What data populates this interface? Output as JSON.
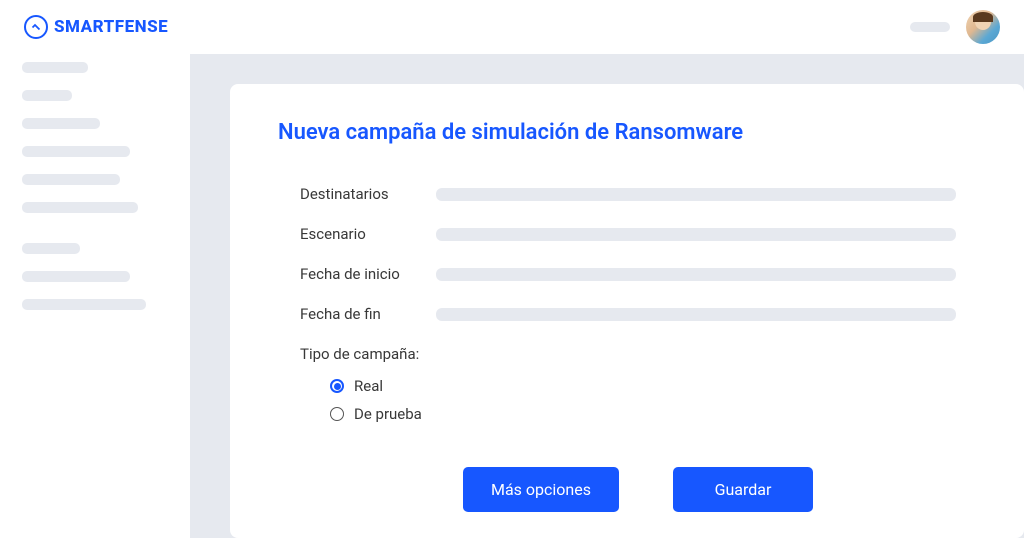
{
  "brand": "SMARTFENSE",
  "card": {
    "title": "Nueva campaña de simulación de Ransomware"
  },
  "form": {
    "recipients_label": "Destinatarios",
    "scenario_label": "Escenario",
    "start_date_label": "Fecha de inicio",
    "end_date_label": "Fecha de fin",
    "campaign_type_label": "Tipo de campaña:",
    "radio_real": "Real",
    "radio_test": "De prueba"
  },
  "buttons": {
    "more_options": "Más opciones",
    "save": "Guardar"
  }
}
